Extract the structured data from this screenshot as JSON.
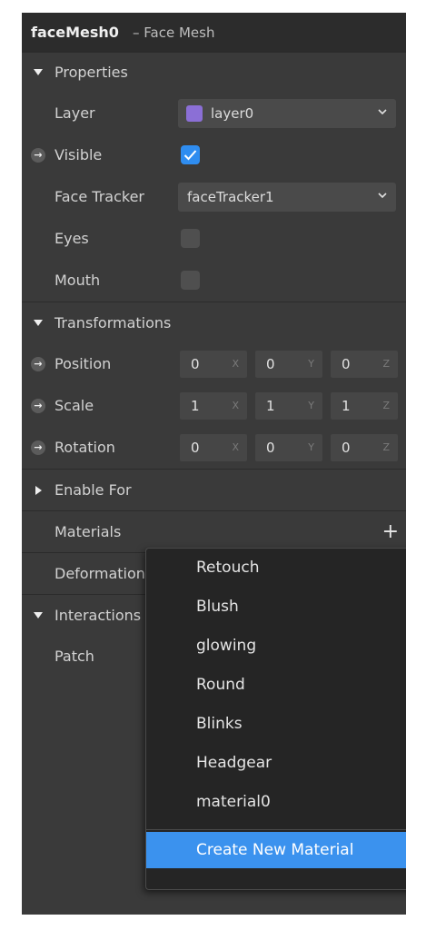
{
  "header": {
    "title": "faceMesh0",
    "subtitle": "– Face Mesh"
  },
  "properties": {
    "label": "Properties",
    "layer": {
      "label": "Layer",
      "value": "layer0",
      "swatch_color": "#8b6fd6"
    },
    "visible": {
      "label": "Visible",
      "checked": true
    },
    "face_tracker": {
      "label": "Face Tracker",
      "value": "faceTracker1"
    },
    "eyes": {
      "label": "Eyes",
      "checked": false
    },
    "mouth": {
      "label": "Mouth",
      "checked": false
    }
  },
  "transformations": {
    "label": "Transformations",
    "position": {
      "label": "Position",
      "x": "0",
      "y": "0",
      "z": "0"
    },
    "scale": {
      "label": "Scale",
      "x": "1",
      "y": "1",
      "z": "1"
    },
    "rotation": {
      "label": "Rotation",
      "x": "0",
      "y": "0",
      "z": "0"
    },
    "axis_labels": {
      "x": "X",
      "y": "Y",
      "z": "Z"
    }
  },
  "enable_for": {
    "label": "Enable For"
  },
  "materials": {
    "label": "Materials",
    "add_icon": "+"
  },
  "deformation": {
    "label": "Deformation"
  },
  "interactions": {
    "label": "Interactions",
    "patch": {
      "label": "Patch"
    }
  },
  "material_menu": {
    "items": [
      "Retouch",
      "Blush",
      "glowing",
      "Round",
      "Blinks",
      "Headgear",
      "material0"
    ],
    "create_label": "Create New Material",
    "highlight_color": "#3b92ee"
  },
  "icons": {
    "link_arrow": "→"
  },
  "colors": {
    "panel": "#3a3a3a",
    "accent": "#2f8df0"
  }
}
